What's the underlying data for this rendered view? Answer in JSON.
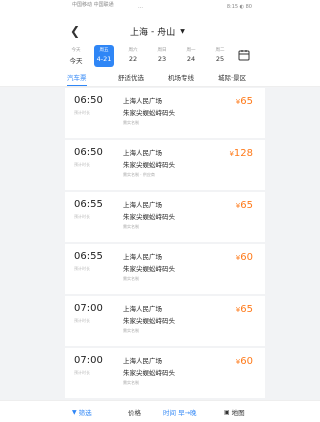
{
  "status": {
    "left": "中国移动 中国联通",
    "mid": "…",
    "right": "8:15 ◐ 80"
  },
  "header": {
    "back_icon": "back-arrow-icon",
    "from": "上海",
    "to": "舟山"
  },
  "dates": [
    {
      "wd": "今天",
      "dd": "今天",
      "active": false
    },
    {
      "wd": "周五",
      "dd": "4-21",
      "active": true
    },
    {
      "wd": "周六",
      "dd": "22",
      "active": false
    },
    {
      "wd": "周日",
      "dd": "23",
      "active": false
    },
    {
      "wd": "周一",
      "dd": "24",
      "active": false
    },
    {
      "wd": "周二",
      "dd": "25",
      "active": false
    }
  ],
  "tabs": [
    {
      "label": "汽车票",
      "active": true
    },
    {
      "label": "舒适优选",
      "active": false
    },
    {
      "label": "机场专线",
      "active": false
    },
    {
      "label": "城际·景区",
      "active": false
    }
  ],
  "trips": [
    {
      "time": "06:50",
      "sub": "预计时长",
      "from": "上海人民广场",
      "to": "朱家尖蜈蚣峙码头",
      "tags": "需实名制",
      "price": "65"
    },
    {
      "time": "06:50",
      "sub": "预计时长",
      "from": "上海人民广场",
      "to": "朱家尖蜈蚣峙码头",
      "tags": "需实名制 · 供应商",
      "price": "128"
    },
    {
      "time": "06:55",
      "sub": "预计时长",
      "from": "上海人民广场",
      "to": "朱家尖蜈蚣峙码头",
      "tags": "需实名制",
      "price": "65"
    },
    {
      "time": "06:55",
      "sub": "预计时长",
      "from": "上海人民广场",
      "to": "朱家尖蜈蚣峙码头",
      "tags": "需实名制",
      "price": "60"
    },
    {
      "time": "07:00",
      "sub": "预计时长",
      "from": "上海人民广场",
      "to": "朱家尖蜈蚣峙码头",
      "tags": "需实名制",
      "price": "65"
    },
    {
      "time": "07:00",
      "sub": "预计时长",
      "from": "上海人民广场",
      "to": "朱家尖蜈蚣峙码头",
      "tags": "需实名制",
      "price": "60"
    }
  ],
  "bottom": {
    "filter": "筛选",
    "price": "价格",
    "time": "时间 早→晚",
    "map": "地图"
  }
}
